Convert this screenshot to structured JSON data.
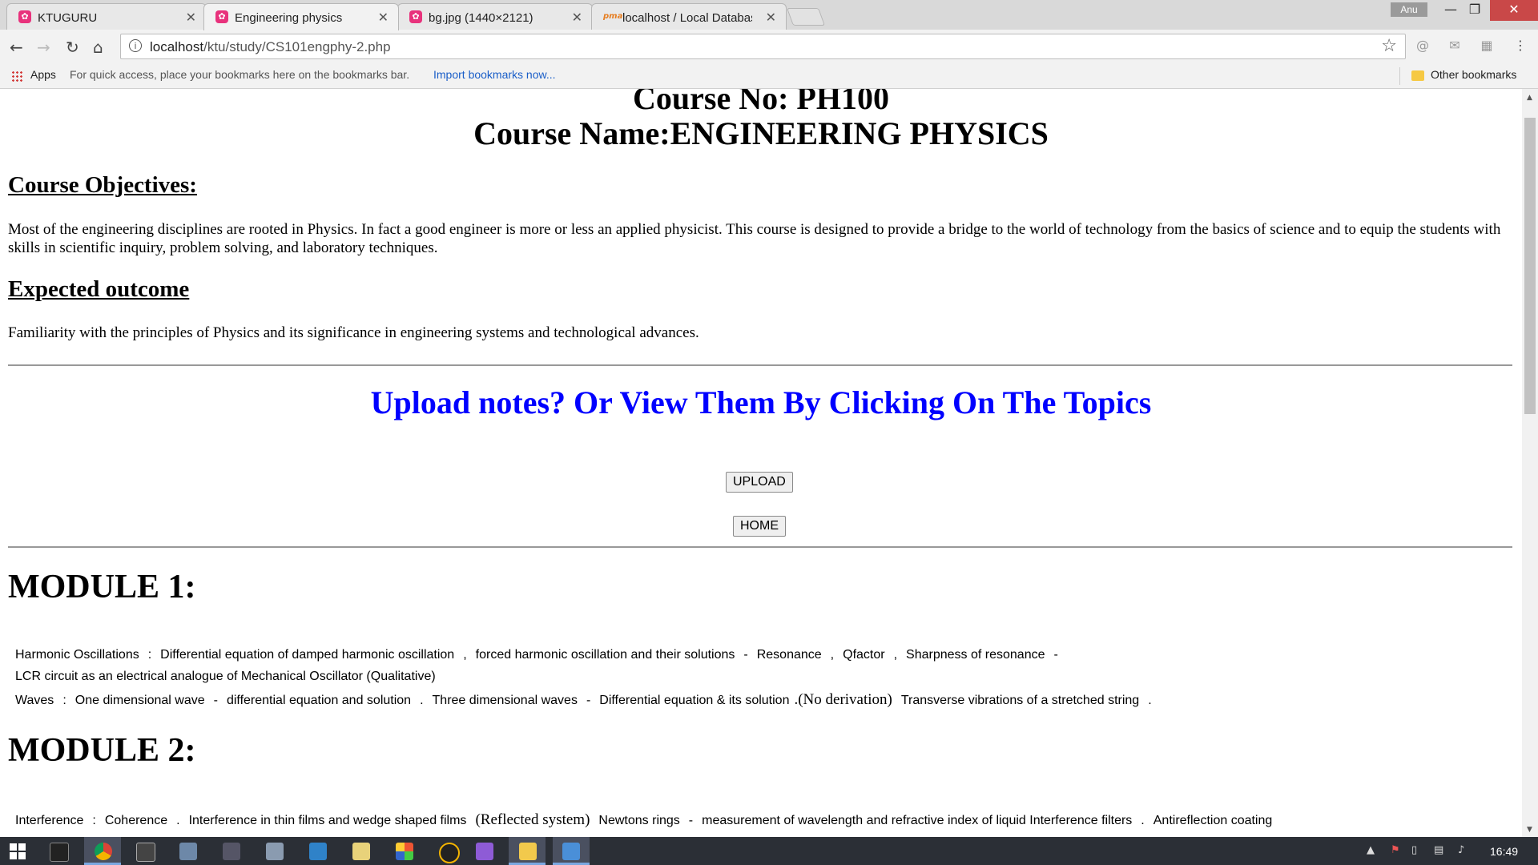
{
  "browser": {
    "tabs": [
      {
        "label": "KTUGURU",
        "icon": "ktu-favicon",
        "active": false
      },
      {
        "label": "Engineering physics",
        "icon": "ktu-favicon",
        "active": true
      },
      {
        "label": "bg.jpg (1440×2121)",
        "icon": "ktu-favicon",
        "active": false
      },
      {
        "label": "localhost / Local Databas",
        "icon": "phpmyadmin-favicon",
        "active": false
      }
    ],
    "profile_name": "Anu",
    "url_host": "localhost",
    "url_path": "/ktu/study/CS101engphy-2.php",
    "bookmarks_bar": {
      "apps_label": "Apps",
      "hint": "For quick access, place your bookmarks here on the bookmarks bar.",
      "import_link": "Import bookmarks now...",
      "other_bookmarks": "Other bookmarks"
    }
  },
  "page": {
    "course_no": "Course No: PH100",
    "course_name": "Course Name:ENGINEERING PHYSICS",
    "objectives_heading": "Course Objectives:",
    "objectives_text": "Most of the engineering disciplines are rooted in Physics. In fact a good engineer is more or less an applied physicist. This course is designed to provide a bridge to the world of technology from the basics of science and to equip the students with skills in scientific inquiry, problem solving, and laboratory techniques.",
    "outcome_heading": "Expected outcome",
    "outcome_text": "Familiarity with the principles of Physics and its significance in engineering systems and technological advances.",
    "upload_heading": "Upload notes? Or View Them By Clicking On The Topics",
    "upload_button": "UPLOAD",
    "home_button": "HOME",
    "modules": [
      {
        "title": "MODULE 1:",
        "line1": {
          "t1": "Harmonic Oscillations",
          "s1": ":",
          "t2": "Differential equation of damped harmonic oscillation",
          "s2": ",",
          "t3": "forced harmonic oscillation and their solutions",
          "s3": "-",
          "t4": "Resonance",
          "s4": ",",
          "t5": "Qfactor",
          "s5": ",",
          "t6": "Sharpness of resonance",
          "s6": "-"
        },
        "line2": {
          "t1": "LCR circuit as an electrical analogue of Mechanical Oscillator (Qualitative)"
        },
        "line3": {
          "t1": "Waves",
          "s1": ":",
          "t2": "One dimensional wave",
          "s2": "-",
          "t3": "differential equation and solution",
          "s3": ".",
          "t4": "Three dimensional waves",
          "s4": "-",
          "t5": "Differential equation & its solution",
          "s5": ".(No derivation)",
          "t6": "Transverse vibrations of a stretched string",
          "s6": "."
        }
      },
      {
        "title": "MODULE 2:",
        "line1": {
          "t1": "Interference",
          "s1": ":",
          "t2": "Coherence",
          "s2": ".",
          "t3": "Interference in thin films and wedge shaped films",
          "s3": "(Reflected system)",
          "t4": "Newtons rings",
          "s4": "-",
          "t5": "measurement of wavelength and refractive index of liquid Interference filters",
          "s5": ".",
          "t6": "Antireflection coating"
        }
      }
    ]
  },
  "taskbar": {
    "clock": "16:49"
  }
}
